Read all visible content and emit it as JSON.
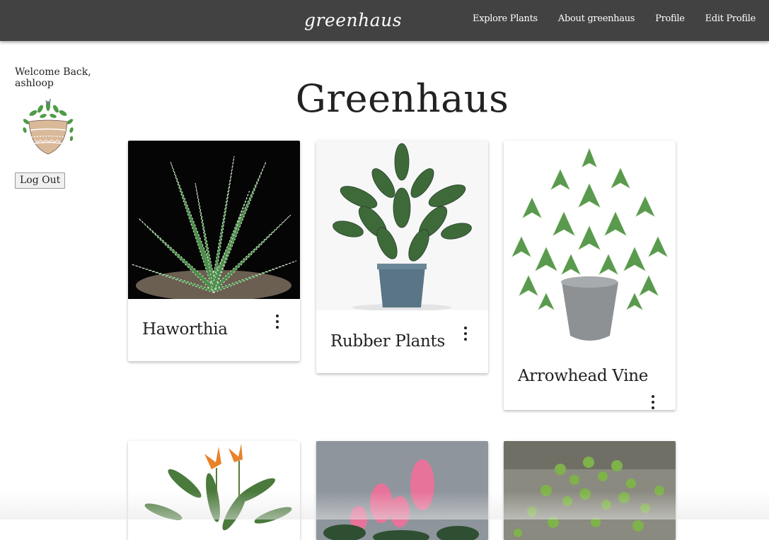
{
  "nav": {
    "brand": "greenhaus",
    "links": [
      "Explore Plants",
      "About greenhaus",
      "Profile",
      "Edit Profile"
    ]
  },
  "sidebar": {
    "welcome_line1": "Welcome Back,",
    "welcome_line2": "ashloop",
    "logout_label": "Log Out"
  },
  "main": {
    "title": "Greenhaus",
    "cards": [
      {
        "name": "Haworthia"
      },
      {
        "name": "Rubber Plants"
      },
      {
        "name": "Arrowhead Vine"
      },
      {
        "name": ""
      },
      {
        "name": ""
      },
      {
        "name": ""
      }
    ]
  },
  "colors": {
    "navbar": "#424242",
    "leaf_green": "#3f8a3a",
    "pot_tan": "#d9b99a"
  }
}
